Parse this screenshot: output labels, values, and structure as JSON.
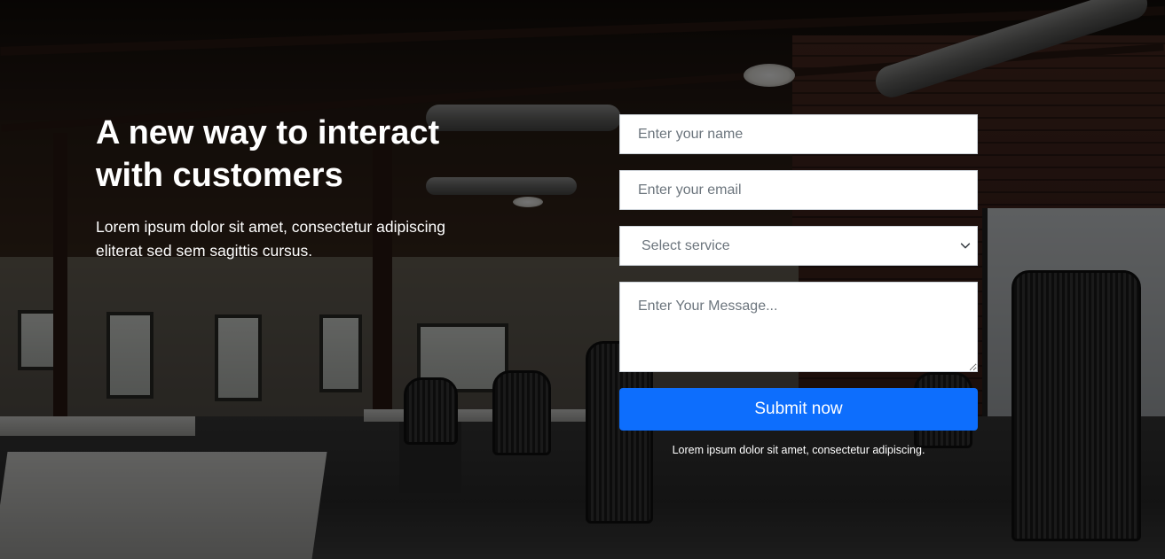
{
  "hero": {
    "headline": "A new way to interact with customers",
    "subtext": "Lorem ipsum dolor sit amet, consectetur adipiscing eliterat sed sem sagittis cursus."
  },
  "form": {
    "name_placeholder": "Enter your name",
    "email_placeholder": "Enter your email",
    "service_selected": "Select service",
    "message_placeholder": "Enter Your Message...",
    "submit_label": "Submit now",
    "note": "Lorem ipsum dolor sit amet, consectetur adipiscing."
  },
  "colors": {
    "accent": "#0d6efd",
    "text_on_dark": "#ffffff",
    "placeholder": "#6c757d"
  },
  "icons": {
    "select_chevron": "chevron-down-icon"
  }
}
